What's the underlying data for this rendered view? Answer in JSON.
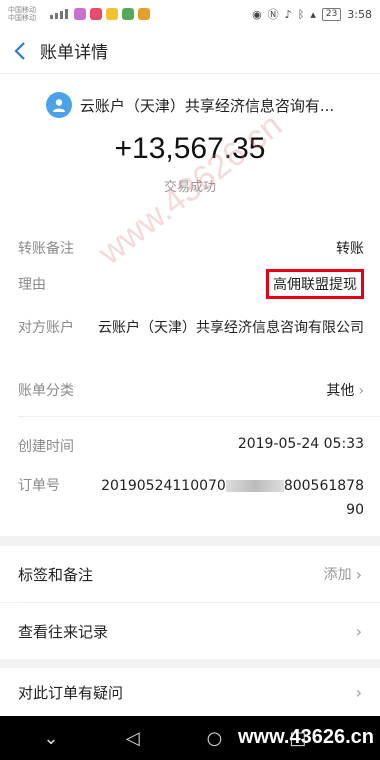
{
  "statusbar": {
    "carrier1": "中国移动",
    "carrier2": "中国移动",
    "battery": "23",
    "time": "3:58"
  },
  "header": {
    "title": "账单详情",
    "back_icon": "back-chevron-icon"
  },
  "summary": {
    "payee": "云账户（天津）共享经济信息咨询有...",
    "amount": "+13,567.35",
    "status": "交易成功"
  },
  "details": {
    "transfer_note_label": "转账备注",
    "transfer_note_value": "转账",
    "reason_label": "理由",
    "reason_value": "高佣联盟提现",
    "counterparty_label": "对方账户",
    "counterparty_value": "云账户（天津）共享经济信息咨询有限公司",
    "category_label": "账单分类",
    "category_value": "其他",
    "created_label": "创建时间",
    "created_value": "2019-05-24 05:33",
    "order_label": "订单号",
    "order_value_start": "20190524110070",
    "order_value_end": "800561878",
    "order_value_tail": "90"
  },
  "actions": {
    "tags_label": "标签和备注",
    "tags_extra": "添加",
    "history_label": "查看往来记录",
    "question_label": "对此订单有疑问"
  },
  "watermark": "www.43626.cn",
  "footer_watermark": "www.43626.cn"
}
